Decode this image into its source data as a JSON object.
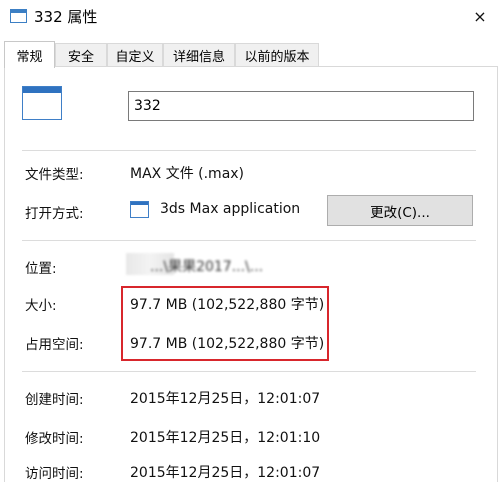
{
  "window": {
    "title": "332 属性",
    "close_glyph": "×"
  },
  "tabs": [
    {
      "label": "常规",
      "active": true
    },
    {
      "label": "安全",
      "active": false
    },
    {
      "label": "自定义",
      "active": false
    },
    {
      "label": "详细信息",
      "active": false
    },
    {
      "label": "以前的版本",
      "active": false
    }
  ],
  "general": {
    "file_name": "332",
    "file_type_label": "文件类型:",
    "file_type_value": "MAX 文件 (.max)",
    "open_with_label": "打开方式:",
    "open_with_value": "3ds Max application",
    "change_button": "更改(C)...",
    "location_label": "位置:",
    "location_value": "...\\果果2017...\\...",
    "size_label": "大小:",
    "size_value": "97.7 MB (102,522,880 字节)",
    "disk_size_label": "占用空间:",
    "disk_size_value": "97.7 MB (102,522,880 字节)",
    "created_label": "创建时间:",
    "created_value": "2015年12月25日，12:01:07",
    "modified_label": "修改时间:",
    "modified_value": "2015年12月25日，12:01:10",
    "accessed_label": "访问时间:",
    "accessed_value": "2015年12月25日，12:01:07"
  },
  "colors": {
    "highlight": "#d8262c",
    "icon_blue": "#2f72c0"
  },
  "icons": {
    "title": "window-icon",
    "file": "file-icon",
    "app": "app-icon"
  }
}
